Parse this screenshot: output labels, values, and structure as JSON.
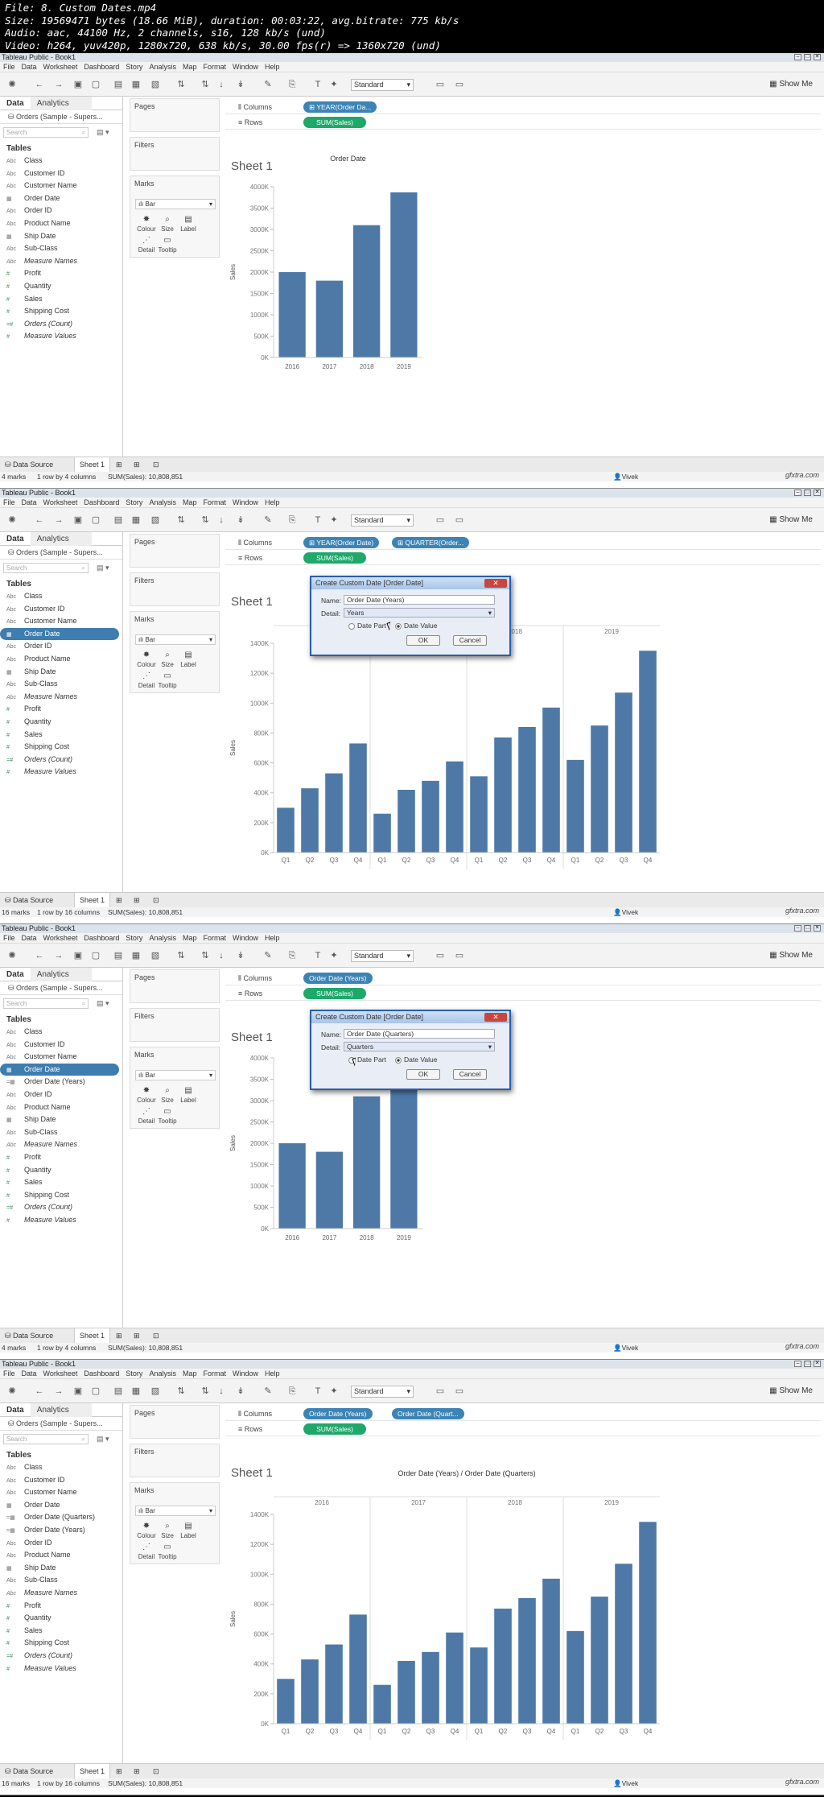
{
  "header": {
    "lines": [
      "File: 8. Custom Dates.mp4",
      "Size: 19569471 bytes (18.66 MiB), duration: 00:03:22, avg.bitrate: 775 kb/s",
      "Audio: aac, 44100 Hz, 2 channels, s16, 128 kb/s (und)",
      "Video: h264, yuv420p, 1280x720, 638 kb/s, 30.00 fps(r) => 1360x720 (und)"
    ]
  },
  "app": {
    "title": "Tableau Public - Book1",
    "menus": [
      "File",
      "Data",
      "Worksheet",
      "Dashboard",
      "Story",
      "Analysis",
      "Map",
      "Format",
      "Window",
      "Help"
    ],
    "standard": "Standard",
    "show_me": "Show Me",
    "data_tab": "Data",
    "analytics_tab": "Analytics",
    "datasource": "Orders (Sample - Supers...",
    "search_placeholder": "Search",
    "tables": "Tables",
    "pages": "Pages",
    "filters": "Filters",
    "marks": "Marks",
    "mark_type": "Bar",
    "mark_buttons": [
      "Colour",
      "Size",
      "Label",
      "Detail",
      "Tooltip"
    ],
    "columns": "Columns",
    "rows": "Rows",
    "sheet_title": "Sheet 1",
    "data_source_tab": "Data Source",
    "sheet_tab": "Sheet 1",
    "user": "Vivek",
    "watermark": "gfxtra.com"
  },
  "frames": [
    {
      "fields": [
        {
          "ico": "Abc",
          "label": "Class"
        },
        {
          "ico": "Abc",
          "label": "Customer ID"
        },
        {
          "ico": "Abc",
          "label": "Customer Name"
        },
        {
          "ico": "▦",
          "label": "Order Date"
        },
        {
          "ico": "Abc",
          "label": "Order ID"
        },
        {
          "ico": "Abc",
          "label": "Product Name"
        },
        {
          "ico": "▦",
          "label": "Ship Date"
        },
        {
          "ico": "Abc",
          "label": "Sub-Class"
        },
        {
          "ico": "Abc",
          "label": "Measure Names",
          "it": true
        },
        {
          "ico": "#",
          "label": "Profit",
          "m": true
        },
        {
          "ico": "#",
          "label": "Quantity",
          "m": true
        },
        {
          "ico": "#",
          "label": "Sales",
          "m": true
        },
        {
          "ico": "#",
          "label": "Shipping Cost",
          "m": true
        },
        {
          "ico": "=#",
          "label": "Orders (Count)",
          "m": true,
          "it": true
        },
        {
          "ico": "#",
          "label": "Measure Values",
          "m": true,
          "it": true
        }
      ],
      "col_pills": [
        "⊞ YEAR(Order Da..."
      ],
      "row_pill": "SUM(Sales)",
      "status": {
        "marks": "4 marks",
        "rc": "1 row by 4 columns",
        "sum": "SUM(Sales): 10,808,851"
      }
    },
    {
      "fields": [
        {
          "ico": "Abc",
          "label": "Class"
        },
        {
          "ico": "Abc",
          "label": "Customer ID"
        },
        {
          "ico": "Abc",
          "label": "Customer Name"
        },
        {
          "ico": "▦",
          "label": "Order Date",
          "hl": true
        },
        {
          "ico": "Abc",
          "label": "Order ID"
        },
        {
          "ico": "Abc",
          "label": "Product Name"
        },
        {
          "ico": "▦",
          "label": "Ship Date"
        },
        {
          "ico": "Abc",
          "label": "Sub-Class"
        },
        {
          "ico": "Abc",
          "label": "Measure Names",
          "it": true
        },
        {
          "ico": "#",
          "label": "Profit",
          "m": true
        },
        {
          "ico": "#",
          "label": "Quantity",
          "m": true
        },
        {
          "ico": "#",
          "label": "Sales",
          "m": true
        },
        {
          "ico": "#",
          "label": "Shipping Cost",
          "m": true
        },
        {
          "ico": "=#",
          "label": "Orders (Count)",
          "m": true,
          "it": true
        },
        {
          "ico": "#",
          "label": "Measure Values",
          "m": true,
          "it": true
        }
      ],
      "col_pills": [
        "⊞ YEAR(Order Date)",
        "⊞ QUARTER(Order..."
      ],
      "row_pill": "SUM(Sales)",
      "dialog": {
        "title": "Create Custom Date [Order Date]",
        "name_label": "Name:",
        "name_value": "Order Date (Years)",
        "detail_label": "Detail:",
        "detail_value": "Years",
        "date_part": "Date Part",
        "date_value": "Date Value",
        "ok": "OK",
        "cancel": "Cancel"
      },
      "status": {
        "marks": "16 marks",
        "rc": "1 row by 16 columns",
        "sum": "SUM(Sales): 10,808,851"
      }
    },
    {
      "fields": [
        {
          "ico": "Abc",
          "label": "Class"
        },
        {
          "ico": "Abc",
          "label": "Customer ID"
        },
        {
          "ico": "Abc",
          "label": "Customer Name"
        },
        {
          "ico": "▦",
          "label": "Order Date",
          "hl": true
        },
        {
          "ico": "=▦",
          "label": "Order Date (Years)"
        },
        {
          "ico": "Abc",
          "label": "Order ID"
        },
        {
          "ico": "Abc",
          "label": "Product Name"
        },
        {
          "ico": "▦",
          "label": "Ship Date"
        },
        {
          "ico": "Abc",
          "label": "Sub-Class"
        },
        {
          "ico": "Abc",
          "label": "Measure Names",
          "it": true
        },
        {
          "ico": "#",
          "label": "Profit",
          "m": true
        },
        {
          "ico": "#",
          "label": "Quantity",
          "m": true
        },
        {
          "ico": "#",
          "label": "Sales",
          "m": true
        },
        {
          "ico": "#",
          "label": "Shipping Cost",
          "m": true
        },
        {
          "ico": "=#",
          "label": "Orders (Count)",
          "m": true,
          "it": true
        },
        {
          "ico": "#",
          "label": "Measure Values",
          "m": true,
          "it": true
        }
      ],
      "col_pills": [
        "Order Date (Years)"
      ],
      "row_pill": "SUM(Sales)",
      "dialog": {
        "title": "Create Custom Date [Order Date]",
        "name_label": "Name:",
        "name_value": "Order Date (Quarters)",
        "detail_label": "Detail:",
        "detail_value": "Quarters",
        "date_part": "Date Part",
        "date_value": "Date Value",
        "ok": "OK",
        "cancel": "Cancel"
      },
      "status": {
        "marks": "4 marks",
        "rc": "1 row by 4 columns",
        "sum": "SUM(Sales): 10,808,851"
      }
    },
    {
      "fields": [
        {
          "ico": "Abc",
          "label": "Class"
        },
        {
          "ico": "Abc",
          "label": "Customer ID"
        },
        {
          "ico": "Abc",
          "label": "Customer Name"
        },
        {
          "ico": "▦",
          "label": "Order Date"
        },
        {
          "ico": "=▦",
          "label": "Order Date (Quarters)"
        },
        {
          "ico": "=▦",
          "label": "Order Date (Years)"
        },
        {
          "ico": "Abc",
          "label": "Order ID"
        },
        {
          "ico": "Abc",
          "label": "Product Name"
        },
        {
          "ico": "▦",
          "label": "Ship Date"
        },
        {
          "ico": "Abc",
          "label": "Sub-Class"
        },
        {
          "ico": "Abc",
          "label": "Measure Names",
          "it": true
        },
        {
          "ico": "#",
          "label": "Profit",
          "m": true
        },
        {
          "ico": "#",
          "label": "Quantity",
          "m": true
        },
        {
          "ico": "#",
          "label": "Sales",
          "m": true
        },
        {
          "ico": "#",
          "label": "Shipping Cost",
          "m": true
        },
        {
          "ico": "=#",
          "label": "Orders (Count)",
          "m": true,
          "it": true
        },
        {
          "ico": "#",
          "label": "Measure Values",
          "m": true,
          "it": true
        }
      ],
      "col_pills": [
        "Order Date (Years)",
        "Order Date (Quart..."
      ],
      "row_pill": "SUM(Sales)",
      "status": {
        "marks": "16 marks",
        "rc": "1 row by 16 columns",
        "sum": "SUM(Sales): 10,808,851"
      }
    }
  ],
  "chart_data": [
    {
      "type": "bar",
      "title": "Order Date",
      "xlabel": "",
      "ylabel": "Sales",
      "categories": [
        "2016",
        "2017",
        "2018",
        "2019"
      ],
      "values": [
        2000,
        1800,
        3100,
        3870
      ],
      "ylim": [
        0,
        4000
      ],
      "yticks": [
        "0K",
        "500K",
        "1000K",
        "1500K",
        "2000K",
        "2500K",
        "3000K",
        "3500K",
        "4000K"
      ],
      "units_per_tick": 500
    },
    {
      "type": "bar",
      "title": "Order Date",
      "xlabel": "",
      "ylabel": "Sales",
      "groups": [
        "2016",
        "2017",
        "2018",
        "2019"
      ],
      "categories": [
        "Q1",
        "Q2",
        "Q3",
        "Q4"
      ],
      "values": [
        300,
        430,
        530,
        730,
        260,
        420,
        480,
        610,
        510,
        770,
        840,
        970,
        620,
        850,
        1070,
        1350
      ],
      "ylim": [
        0,
        1400
      ],
      "yticks": [
        "0K",
        "200K",
        "400K",
        "600K",
        "800K",
        "1000K",
        "1200K",
        "1400K"
      ],
      "units_per_tick": 200
    },
    {
      "type": "bar",
      "title": "Order Date (Years)",
      "xlabel": "",
      "ylabel": "Sales",
      "categories": [
        "2016",
        "2017",
        "2018",
        "2019"
      ],
      "values": [
        2000,
        1800,
        3100,
        3870
      ],
      "ylim": [
        0,
        4000
      ],
      "yticks": [
        "0K",
        "500K",
        "1000K",
        "1500K",
        "2000K",
        "2500K",
        "3000K",
        "3500K",
        "4000K"
      ],
      "units_per_tick": 500
    },
    {
      "type": "bar",
      "title": "Order Date (Years) / Order Date (Quarters)",
      "xlabel": "",
      "ylabel": "Sales",
      "groups": [
        "2016",
        "2017",
        "2018",
        "2019"
      ],
      "categories": [
        "Q1",
        "Q2",
        "Q3",
        "Q4"
      ],
      "values": [
        300,
        430,
        530,
        730,
        260,
        420,
        480,
        610,
        510,
        770,
        840,
        970,
        620,
        850,
        1070,
        1350
      ],
      "ylim": [
        0,
        1400
      ],
      "yticks": [
        "0K",
        "200K",
        "400K",
        "600K",
        "800K",
        "1000K",
        "1200K",
        "1400K"
      ],
      "units_per_tick": 200
    }
  ],
  "colors": {
    "bar": "#4e79a7",
    "pill_blue": "#3c84b5",
    "pill_green": "#1ea86a"
  }
}
